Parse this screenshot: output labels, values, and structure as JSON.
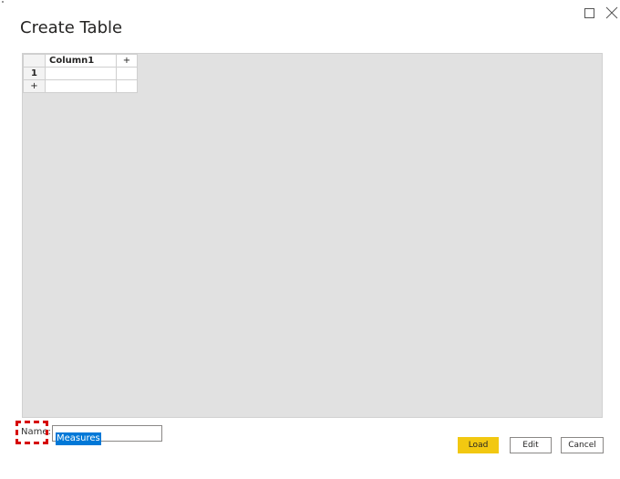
{
  "dialog": {
    "title": "Create Table"
  },
  "window_controls": {
    "maximize_icon": "maximize-icon",
    "close_icon": "close-icon"
  },
  "table": {
    "columns": [
      "Column1"
    ],
    "add_column_symbol": "+",
    "rows": [
      {
        "row_number": "1",
        "cells": [
          ""
        ]
      }
    ],
    "add_row_symbol": "+"
  },
  "name_field": {
    "label": "Name:",
    "value": "Measures"
  },
  "buttons": {
    "load": "Load",
    "edit": "Edit",
    "cancel": "Cancel"
  },
  "colors": {
    "accent": "#f2c811",
    "selection": "#0078d7",
    "highlight_box": "#d60000",
    "grid_background": "#e1e1e1"
  }
}
